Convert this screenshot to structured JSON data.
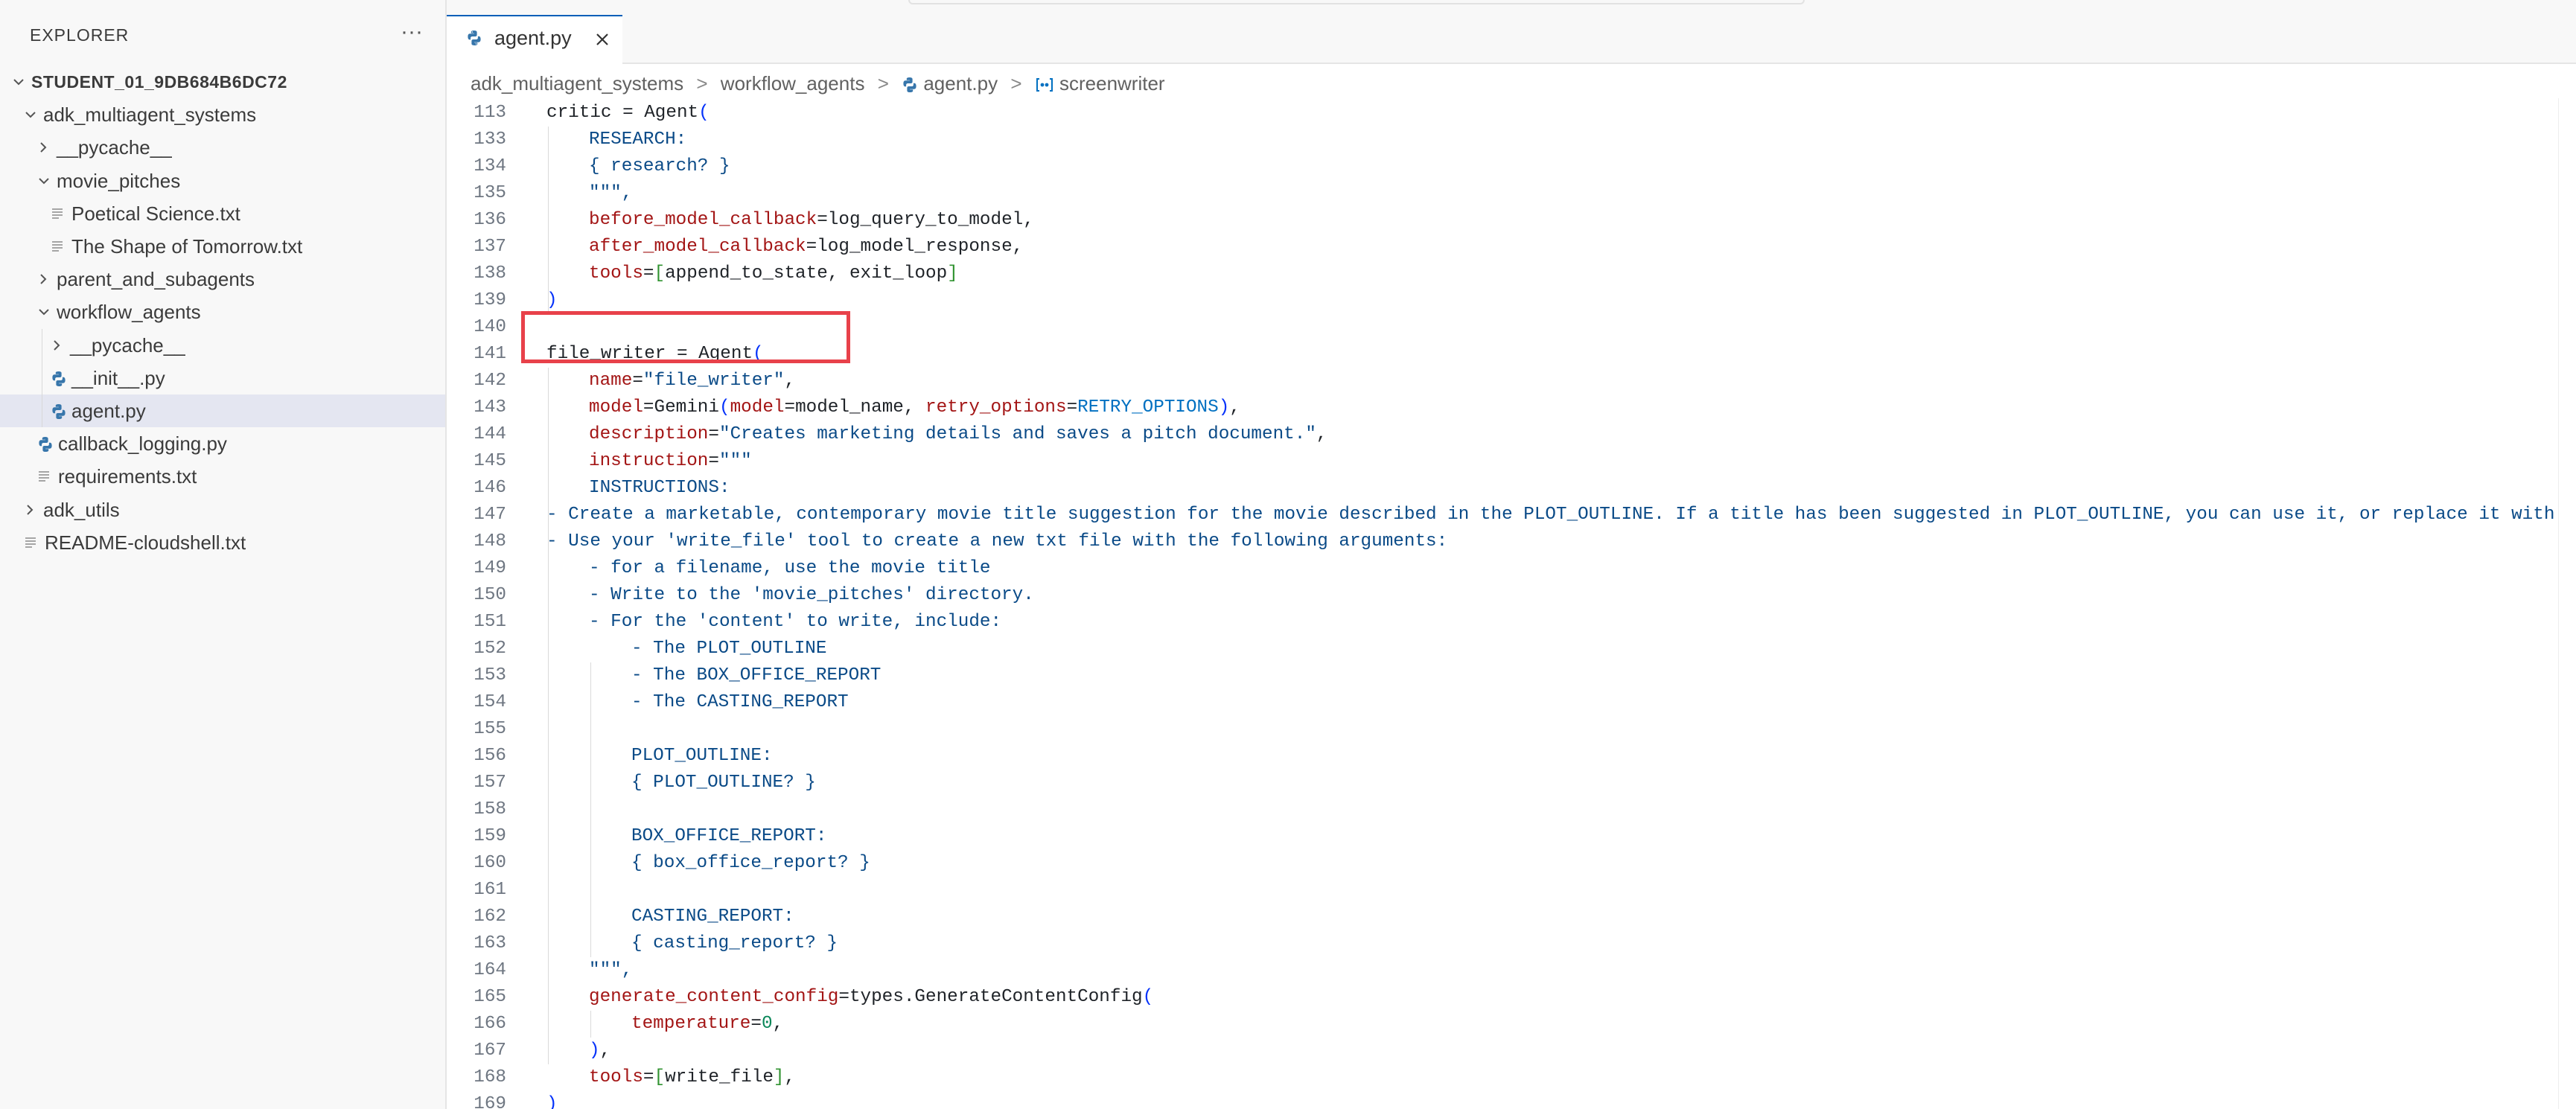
{
  "explorer": {
    "header": "EXPLORER",
    "more_icon": "ellipsis-icon",
    "tree": [
      {
        "label": "STUDENT_01_9DB684B6DC72",
        "depth": 0,
        "type": "root",
        "expanded": true
      },
      {
        "label": "adk_multiagent_systems",
        "depth": 1,
        "type": "folder",
        "expanded": true
      },
      {
        "label": "__pycache__",
        "depth": 2,
        "type": "folder",
        "expanded": false
      },
      {
        "label": "movie_pitches",
        "depth": 2,
        "type": "folder",
        "expanded": true
      },
      {
        "label": "Poetical Science.txt",
        "depth": 3,
        "type": "txt"
      },
      {
        "label": "The Shape of Tomorrow.txt",
        "depth": 3,
        "type": "txt"
      },
      {
        "label": "parent_and_subagents",
        "depth": 2,
        "type": "folder",
        "expanded": false
      },
      {
        "label": "workflow_agents",
        "depth": 2,
        "type": "folder",
        "expanded": true
      },
      {
        "label": "__pycache__",
        "depth": 3,
        "type": "folder",
        "expanded": false
      },
      {
        "label": "__init__.py",
        "depth": 3,
        "type": "py"
      },
      {
        "label": "agent.py",
        "depth": 3,
        "type": "py",
        "active": true
      },
      {
        "label": "callback_logging.py",
        "depth": 2,
        "type": "py"
      },
      {
        "label": "requirements.txt",
        "depth": 2,
        "type": "txt"
      },
      {
        "label": "adk_utils",
        "depth": 1,
        "type": "folder",
        "expanded": false
      },
      {
        "label": "README-cloudshell.txt",
        "depth": 1,
        "type": "txt"
      }
    ]
  },
  "tab": {
    "label": "agent.py",
    "icon": "python-file-icon",
    "close_icon": "close-icon"
  },
  "breadcrumb": {
    "items": [
      "adk_multiagent_systems",
      "workflow_agents",
      "agent.py",
      "screenwriter"
    ],
    "separator": ">"
  },
  "colors": {
    "accent": "#005fb8",
    "highlight_box": "#e8414a",
    "active_row": "#e4e6f1"
  },
  "editor": {
    "lines": [
      {
        "n": "113",
        "indent": 0,
        "tokens": [
          [
            "critic = Agent",
            "plain"
          ],
          [
            "(",
            "paren"
          ]
        ]
      },
      {
        "n": "133",
        "indent": 1,
        "tokens": [
          [
            "RESEARCH:",
            "str"
          ]
        ]
      },
      {
        "n": "134",
        "indent": 1,
        "tokens": [
          [
            "{ research? }",
            "str"
          ]
        ]
      },
      {
        "n": "135",
        "indent": 1,
        "tokens": [
          [
            "\"\"\",",
            "str"
          ]
        ]
      },
      {
        "n": "136",
        "indent": 1,
        "tokens": [
          [
            "before_model_callback",
            "param"
          ],
          [
            "=log_query_to_model,",
            "plain"
          ]
        ]
      },
      {
        "n": "137",
        "indent": 1,
        "tokens": [
          [
            "after_model_callback",
            "param"
          ],
          [
            "=log_model_response,",
            "plain"
          ]
        ]
      },
      {
        "n": "138",
        "indent": 1,
        "tokens": [
          [
            "tools",
            "param"
          ],
          [
            "=",
            "plain"
          ],
          [
            "[",
            "brack"
          ],
          [
            "append_to_state, exit_loop",
            "plain"
          ],
          [
            "]",
            "brack"
          ]
        ]
      },
      {
        "n": "139",
        "indent": 0,
        "tokens": [
          [
            ")",
            "paren"
          ]
        ]
      },
      {
        "n": "140",
        "indent": 0,
        "tokens": []
      },
      {
        "n": "141",
        "indent": 0,
        "tokens": [
          [
            "file_writer = Agent",
            "plain"
          ],
          [
            "(",
            "paren"
          ]
        ]
      },
      {
        "n": "142",
        "indent": 1,
        "tokens": [
          [
            "name",
            "param"
          ],
          [
            "=",
            "plain"
          ],
          [
            "\"file_writer\"",
            "str"
          ],
          [
            ",",
            "plain"
          ]
        ]
      },
      {
        "n": "143",
        "indent": 1,
        "tokens": [
          [
            "model",
            "param"
          ],
          [
            "=Gemini",
            "plain"
          ],
          [
            "(",
            "paren"
          ],
          [
            "model",
            "param"
          ],
          [
            "=model_name, ",
            "plain"
          ],
          [
            "retry_options",
            "param"
          ],
          [
            "=",
            "plain"
          ],
          [
            "RETRY_OPTIONS",
            "const"
          ],
          [
            ")",
            "paren"
          ],
          [
            ",",
            "plain"
          ]
        ]
      },
      {
        "n": "144",
        "indent": 1,
        "tokens": [
          [
            "description",
            "param"
          ],
          [
            "=",
            "plain"
          ],
          [
            "\"Creates marketing details and saves a pitch document.\"",
            "str"
          ],
          [
            ",",
            "plain"
          ]
        ]
      },
      {
        "n": "145",
        "indent": 1,
        "tokens": [
          [
            "instruction",
            "param"
          ],
          [
            "=",
            "plain"
          ],
          [
            "\"\"\"",
            "str"
          ]
        ]
      },
      {
        "n": "146",
        "indent": 1,
        "tokens": [
          [
            "INSTRUCTIONS:",
            "str"
          ]
        ]
      },
      {
        "n": "147",
        "indent": 0,
        "tokens": [
          [
            "- Create a marketable, contemporary movie title suggestion for the movie described in the PLOT_OUTLINE. If a title has been suggested in PLOT_OUTLINE, you can use it, or replace it with a better one.",
            "str"
          ]
        ]
      },
      {
        "n": "148",
        "indent": 0,
        "tokens": [
          [
            "- Use your 'write_file' tool to create a new txt file with the following arguments:",
            "str"
          ]
        ]
      },
      {
        "n": "149",
        "indent": 1,
        "tokens": [
          [
            "- for a filename, use the movie title",
            "str"
          ]
        ]
      },
      {
        "n": "150",
        "indent": 1,
        "tokens": [
          [
            "- Write to the 'movie_pitches' directory.",
            "str"
          ]
        ]
      },
      {
        "n": "151",
        "indent": 1,
        "tokens": [
          [
            "- For the 'content' to write, include:",
            "str"
          ]
        ]
      },
      {
        "n": "152",
        "indent": 2,
        "tokens": [
          [
            "- The PLOT_OUTLINE",
            "str"
          ]
        ]
      },
      {
        "n": "153",
        "indent": 2,
        "tokens": [
          [
            "- The BOX_OFFICE_REPORT",
            "str"
          ]
        ]
      },
      {
        "n": "154",
        "indent": 2,
        "tokens": [
          [
            "- The CASTING_REPORT",
            "str"
          ]
        ]
      },
      {
        "n": "155",
        "indent": 2,
        "tokens": []
      },
      {
        "n": "156",
        "indent": 2,
        "tokens": [
          [
            "PLOT_OUTLINE:",
            "str"
          ]
        ]
      },
      {
        "n": "157",
        "indent": 2,
        "tokens": [
          [
            "{ PLOT_OUTLINE? }",
            "str"
          ]
        ]
      },
      {
        "n": "158",
        "indent": 2,
        "tokens": []
      },
      {
        "n": "159",
        "indent": 2,
        "tokens": [
          [
            "BOX_OFFICE_REPORT:",
            "str"
          ]
        ]
      },
      {
        "n": "160",
        "indent": 2,
        "tokens": [
          [
            "{ box_office_report? }",
            "str"
          ]
        ]
      },
      {
        "n": "161",
        "indent": 2,
        "tokens": []
      },
      {
        "n": "162",
        "indent": 2,
        "tokens": [
          [
            "CASTING_REPORT:",
            "str"
          ]
        ]
      },
      {
        "n": "163",
        "indent": 2,
        "tokens": [
          [
            "{ casting_report? }",
            "str"
          ]
        ]
      },
      {
        "n": "164",
        "indent": 1,
        "tokens": [
          [
            "\"\"\",",
            "str"
          ]
        ]
      },
      {
        "n": "165",
        "indent": 1,
        "tokens": [
          [
            "generate_content_config",
            "param"
          ],
          [
            "=types.GenerateContentConfig",
            "plain"
          ],
          [
            "(",
            "paren"
          ]
        ]
      },
      {
        "n": "166",
        "indent": 2,
        "tokens": [
          [
            "temperature",
            "param"
          ],
          [
            "=",
            "plain"
          ],
          [
            "0",
            "num"
          ],
          [
            ",",
            "plain"
          ]
        ]
      },
      {
        "n": "167",
        "indent": 1,
        "tokens": [
          [
            ")",
            "paren"
          ],
          [
            ",",
            "plain"
          ]
        ]
      },
      {
        "n": "168",
        "indent": 1,
        "tokens": [
          [
            "tools",
            "param"
          ],
          [
            "=",
            "plain"
          ],
          [
            "[",
            "brack"
          ],
          [
            "write_file",
            "plain"
          ],
          [
            "]",
            "brack"
          ],
          [
            ",",
            "plain"
          ]
        ]
      },
      {
        "n": "169",
        "indent": 0,
        "tokens": [
          [
            ")",
            "paren"
          ]
        ]
      }
    ]
  }
}
